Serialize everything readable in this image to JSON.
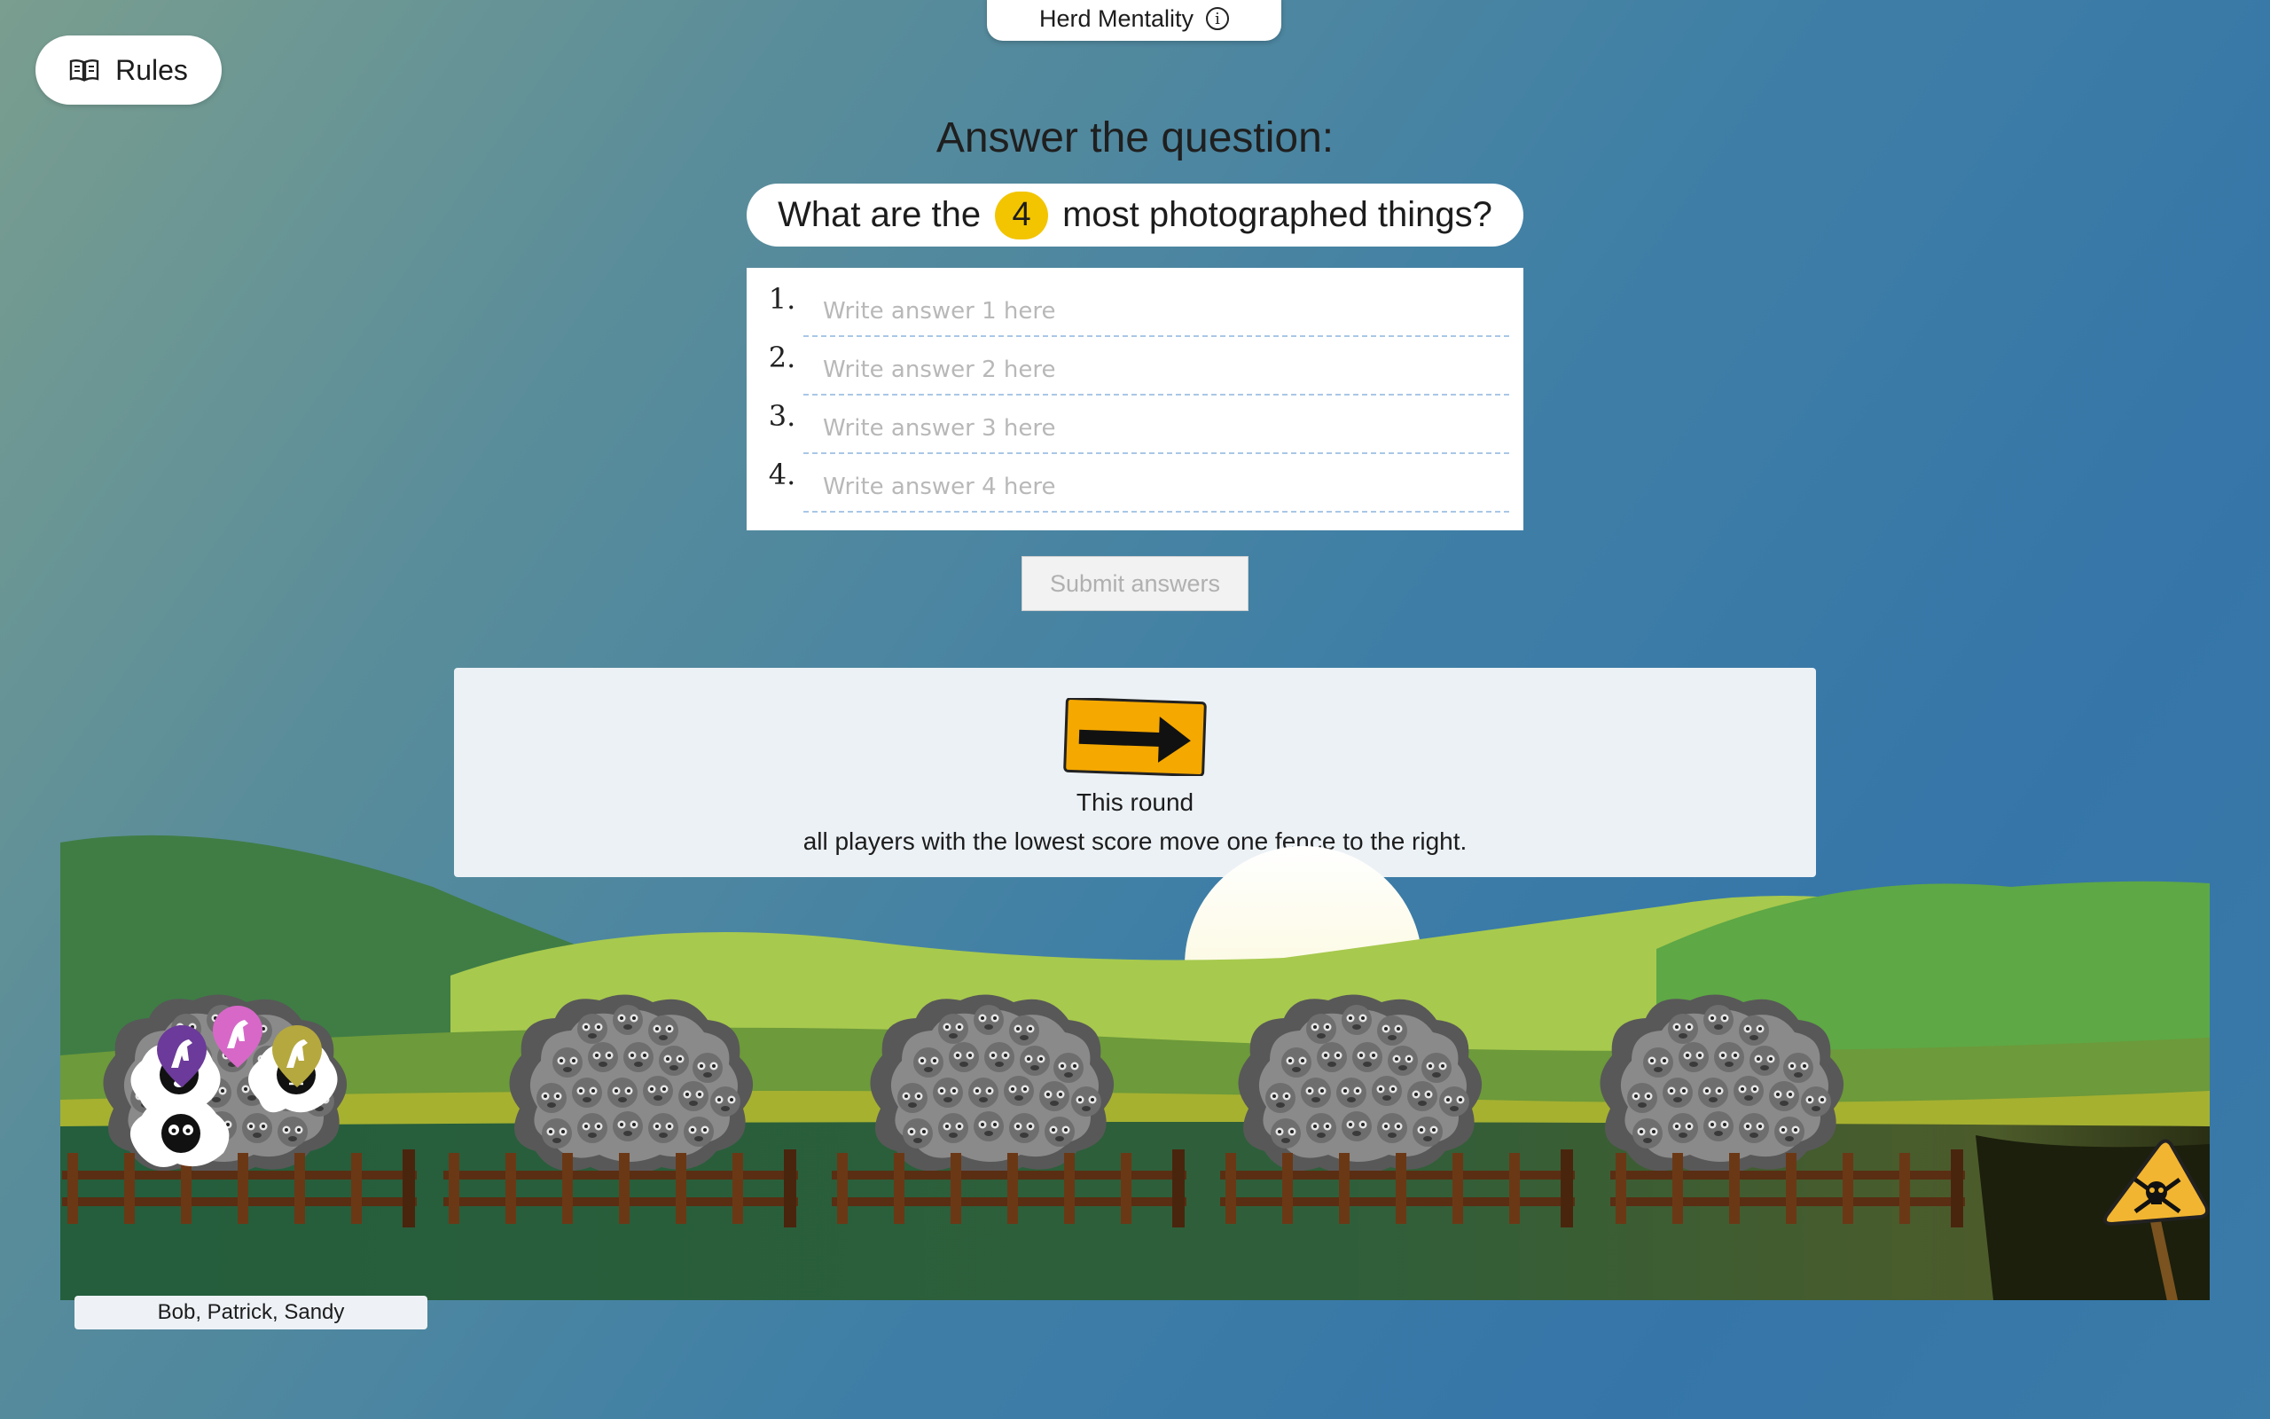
{
  "header": {
    "title": "Herd Mentality"
  },
  "rules_button": {
    "label": "Rules"
  },
  "question": {
    "heading": "Answer the question:",
    "prefix": "What are the",
    "count": "4",
    "suffix": "most photographed things?"
  },
  "answers": [
    {
      "number": "1.",
      "placeholder": "Write answer 1 here"
    },
    {
      "number": "2.",
      "placeholder": "Write answer 2 here"
    },
    {
      "number": "3.",
      "placeholder": "Write answer 3 here"
    },
    {
      "number": "4.",
      "placeholder": "Write answer 4 here"
    }
  ],
  "submit_button": {
    "label": "Submit answers"
  },
  "round_rule": {
    "title": "This round",
    "description": "all players with the lowest score move one fence to the right."
  },
  "players": {
    "names": "Bob, Patrick, Sandy"
  },
  "colors": {
    "badge": "#f2c500",
    "sign": "#f5a800",
    "player_purple": "#6b3a9a",
    "player_pink": "#d768c8",
    "player_olive": "#b5a83e"
  },
  "icons": [
    "info-icon",
    "book-icon",
    "arrow-right-icon",
    "skull-warning-icon",
    "sheep-icon"
  ]
}
